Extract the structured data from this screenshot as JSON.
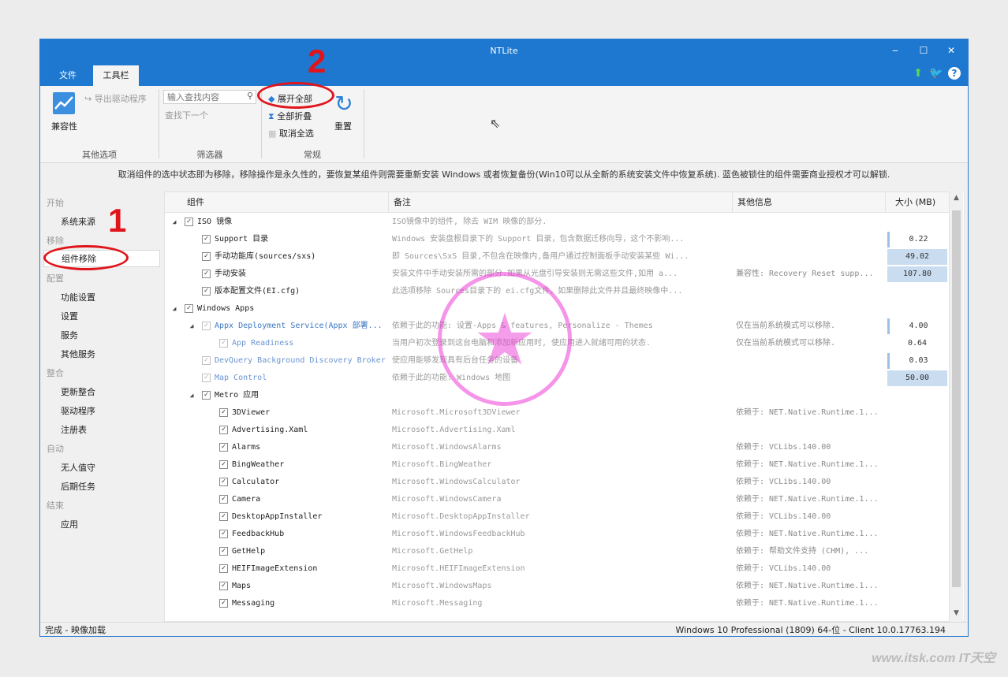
{
  "window": {
    "title": "NTLite",
    "controls": {
      "minimize": "‒",
      "maximize": "☐",
      "close": "✕"
    }
  },
  "tabs": [
    {
      "label": "文件"
    },
    {
      "label": "工具栏"
    }
  ],
  "ribbon": {
    "compat_label": "兼容性",
    "export_driver": "导出驱动程序",
    "group_other": "其他选项",
    "search_placeholder": "输入查找内容",
    "find_next": "查找下一个",
    "group_filter": "筛选器",
    "expand_all": "展开全部",
    "collapse_all": "全部折叠",
    "deselect_all": "取消全选",
    "group_common": "常规",
    "reset": "重置"
  },
  "info": "取消组件的选中状态即为移除，移除操作是永久性的，要恢复某组件则需要重新安装 Windows 或者恢复备份(Win10可以从全新的系统安装文件中恢复系统). 蓝色被锁住的组件需要商业授权才可以解锁.",
  "sidebar": {
    "sections": [
      {
        "label": "开始",
        "items": [
          "系统来源"
        ]
      },
      {
        "label": "移除",
        "items": [
          "组件移除"
        ]
      },
      {
        "label": "配置",
        "items": [
          "功能设置",
          "设置",
          "服务",
          "其他服务"
        ]
      },
      {
        "label": "整合",
        "items": [
          "更新整合",
          "驱动程序",
          "注册表"
        ]
      },
      {
        "label": "自动",
        "items": [
          "无人值守",
          "后期任务"
        ]
      },
      {
        "label": "结束",
        "items": [
          "应用"
        ]
      }
    ]
  },
  "grid": {
    "headers": {
      "component": "组件",
      "note": "备注",
      "other": "其他信息",
      "size": "大小 (MB)"
    },
    "rows": [
      {
        "name": "ISO 镜像",
        "note": "ISO镜像中的组件, 除去 WIM 映像的部分.",
        "other": "",
        "size": ""
      },
      {
        "name": "Support 目录",
        "note": "Windows 安装盘根目录下的 Support 目录，包含数据迁移向导，这个不影响...",
        "other": "",
        "size": "0.22"
      },
      {
        "name": "手动功能库(sources/sxs)",
        "note": "即 Sources\\SxS 目录,不包含在映像内,备用户通过控制面板手动安装某些 Wi...",
        "other": "",
        "size": "49.02"
      },
      {
        "name": "手动安装",
        "note": "安装文件中手动安装所需的部分.如果从光盘引导安装则无需这些文件,如用 a...",
        "other": "兼容性:  Recovery Reset supp...",
        "size": "107.80"
      },
      {
        "name": "版本配置文件(EI.cfg)",
        "note": "此选项移除 Sources目录下的 ei.cfg文件，如果删除此文件并且最终映像中...",
        "other": "",
        "size": ""
      },
      {
        "name": "Windows Apps",
        "note": "",
        "other": "",
        "size": ""
      },
      {
        "name": "Appx Deployment Service(Appx 部署...",
        "note": "依赖于此的功能: 设置-Apps & features, Personalize - Themes",
        "other": "仅在当前系统模式可以移除.",
        "size": "4.00"
      },
      {
        "name": "App Readiness",
        "note": "当用户初次登录到这台电脑和添加新应用时, 使应用进入就绪可用的状态.",
        "other": "仅在当前系统模式可以移除.",
        "size": "0.64"
      },
      {
        "name": "DevQuery Background Discovery Broker",
        "note": "使应用能够发现具有后台任务的设备",
        "other": "",
        "size": "0.03"
      },
      {
        "name": "Map Control",
        "note": "依赖于此的功能: Windows 地图",
        "other": "",
        "size": "50.00"
      },
      {
        "name": "Metro 应用",
        "note": "",
        "other": "",
        "size": ""
      },
      {
        "name": "3DViewer",
        "note": "Microsoft.Microsoft3DViewer",
        "other": "依赖于: NET.Native.Runtime.1...",
        "size": ""
      },
      {
        "name": "Advertising.Xaml",
        "note": "Microsoft.Advertising.Xaml",
        "other": "",
        "size": ""
      },
      {
        "name": "Alarms",
        "note": "Microsoft.WindowsAlarms",
        "other": "依赖于: VCLibs.140.00",
        "size": ""
      },
      {
        "name": "BingWeather",
        "note": "Microsoft.BingWeather",
        "other": "依赖于: NET.Native.Runtime.1...",
        "size": ""
      },
      {
        "name": "Calculator",
        "note": "Microsoft.WindowsCalculator",
        "other": "依赖于: VCLibs.140.00",
        "size": ""
      },
      {
        "name": "Camera",
        "note": "Microsoft.WindowsCamera",
        "other": "依赖于: NET.Native.Runtime.1...",
        "size": ""
      },
      {
        "name": "DesktopAppInstaller",
        "note": "Microsoft.DesktopAppInstaller",
        "other": "依赖于: VCLibs.140.00",
        "size": ""
      },
      {
        "name": "FeedbackHub",
        "note": "Microsoft.WindowsFeedbackHub",
        "other": "依赖于: NET.Native.Runtime.1...",
        "size": ""
      },
      {
        "name": "GetHelp",
        "note": "Microsoft.GetHelp",
        "other": "依赖于: 帮助文件支持 (CHM), ...",
        "size": ""
      },
      {
        "name": "HEIFImageExtension",
        "note": "Microsoft.HEIFImageExtension",
        "other": "依赖于: VCLibs.140.00",
        "size": ""
      },
      {
        "name": "Maps",
        "note": "Microsoft.WindowsMaps",
        "other": "依赖于: NET.Native.Runtime.1...",
        "size": ""
      },
      {
        "name": "Messaging",
        "note": "Microsoft.Messaging",
        "other": "依赖于: NET.Native.Runtime.1...",
        "size": ""
      }
    ]
  },
  "status": {
    "left": "完成 - 映像加载",
    "right": "Windows 10 Professional (1809) 64-位 - Client 10.0.17763.194"
  },
  "annotations": {
    "one": "1",
    "two": "2"
  },
  "stamp": {
    "text": "IT天空 www.itsk.com"
  },
  "watermark": "www.itsk.com IT天空"
}
